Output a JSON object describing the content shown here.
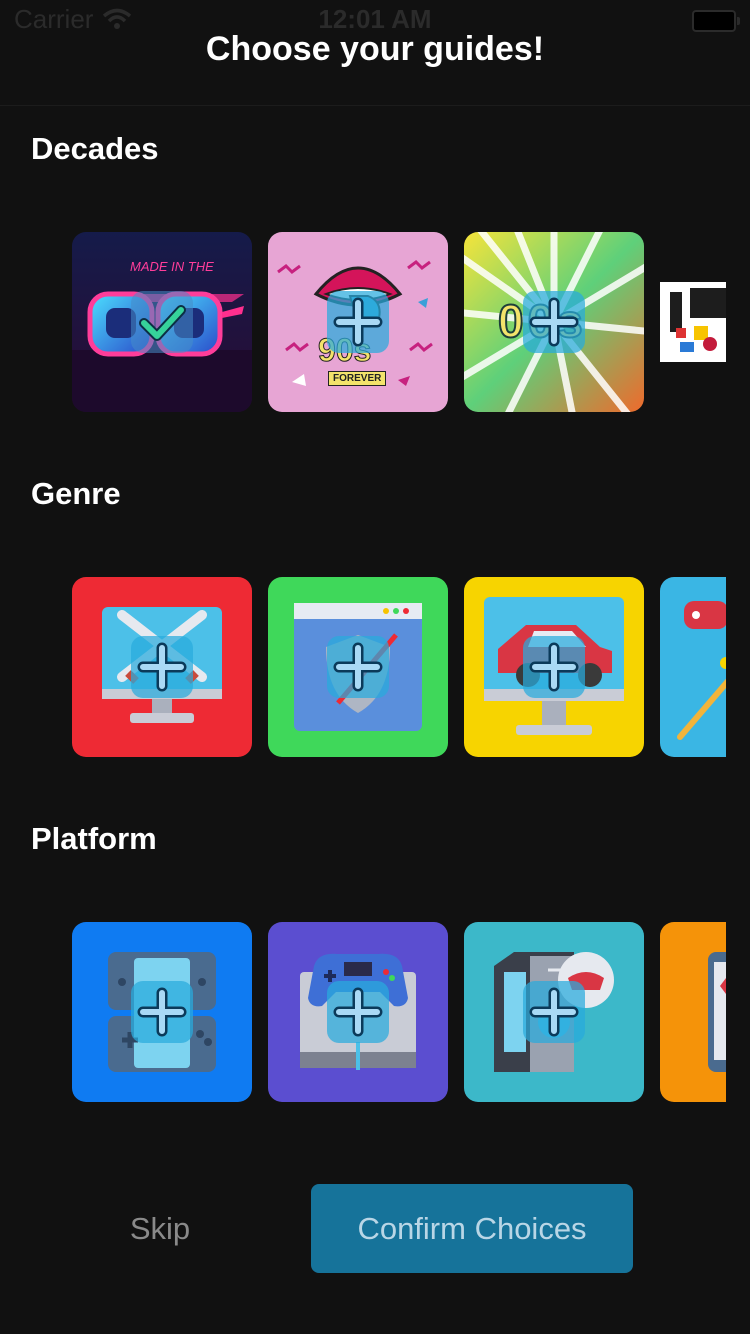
{
  "status_bar": {
    "carrier": "Carrier",
    "time": "12:01 AM"
  },
  "title": "Choose your guides!",
  "sections": [
    {
      "title": "Decades",
      "items": [
        {
          "name": "80s",
          "selected": true,
          "text": "MADE IN THE"
        },
        {
          "name": "90s",
          "selected": false,
          "text": "90s",
          "subtext": "FOREVER"
        },
        {
          "name": "00s",
          "selected": false,
          "text": "00s"
        },
        {
          "name": "10s",
          "selected": false
        }
      ]
    },
    {
      "title": "Genre",
      "items": [
        {
          "name": "action",
          "selected": false,
          "bg": "#EE2A34"
        },
        {
          "name": "strategy",
          "selected": false,
          "bg": "#3FD85A"
        },
        {
          "name": "racing",
          "selected": false,
          "bg": "#F7D400"
        },
        {
          "name": "sports",
          "selected": false,
          "bg": "#3AB6E4"
        }
      ]
    },
    {
      "title": "Platform",
      "items": [
        {
          "name": "handheld",
          "selected": false,
          "bg": "#0F7BF2"
        },
        {
          "name": "console",
          "selected": false,
          "bg": "#5B4ED0"
        },
        {
          "name": "pc",
          "selected": false,
          "bg": "#3CB8C9"
        },
        {
          "name": "mobile",
          "selected": false,
          "bg": "#F59309"
        }
      ]
    }
  ],
  "buttons": {
    "skip": "Skip",
    "confirm": "Confirm Choices"
  },
  "colors": {
    "background": "#111111",
    "confirm_bg": "#16739A",
    "badge": "#28AADC"
  },
  "icons": {
    "add": "plus-icon",
    "selected": "checkmark-icon"
  }
}
